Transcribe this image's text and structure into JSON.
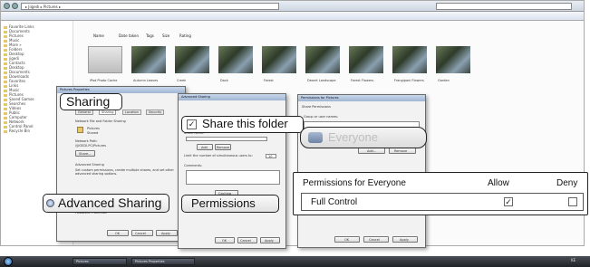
{
  "explorer": {
    "address": "▸ Jiigedi ▸ Pictures ▸",
    "sidebar": [
      {
        "label": "Favorite Links"
      },
      {
        "label": "Documents"
      },
      {
        "label": "Pictures"
      },
      {
        "label": "Music"
      },
      {
        "label": "More »"
      },
      {
        "label": "Folders"
      },
      {
        "label": "Desktop"
      },
      {
        "label": "jigedi"
      },
      {
        "label": "Contacts"
      },
      {
        "label": "Desktop"
      },
      {
        "label": "Documents"
      },
      {
        "label": "Downloads"
      },
      {
        "label": "Favorites"
      },
      {
        "label": "Links"
      },
      {
        "label": "Music"
      },
      {
        "label": "Pictures"
      },
      {
        "label": "Saved Games"
      },
      {
        "label": "Searches"
      },
      {
        "label": "Videos"
      },
      {
        "label": "Public"
      },
      {
        "label": "Computer"
      },
      {
        "label": "Network"
      },
      {
        "label": "Control Panel"
      },
      {
        "label": "Recycle Bin"
      }
    ],
    "columns": [
      "Name",
      "Date taken",
      "Tags",
      "Size",
      "Rating"
    ],
    "thumbnails": [
      {
        "caption": "iPod Photo Cache"
      },
      {
        "caption": "Autumn Leaves"
      },
      {
        "caption": "Creek"
      },
      {
        "caption": "Dock"
      },
      {
        "caption": "Forest"
      },
      {
        "caption": "Desert Landscape"
      },
      {
        "caption": "Forest Flowers"
      },
      {
        "caption": "Frangipani Flowers"
      },
      {
        "caption": "Garden"
      }
    ]
  },
  "callouts": {
    "sharing": "Sharing",
    "advanced_sharing": "Advanced Sharing",
    "share_this_folder": "Share this folder",
    "permissions": "Permissions",
    "everyone": "Everyone"
  },
  "permissions_panel": {
    "header": "Permissions for Everyone",
    "allow": "Allow",
    "deny": "Deny",
    "row_label": "Full Control",
    "allow_checked": true,
    "deny_checked": false
  },
  "dialog1": {
    "title": "Pictures Properties",
    "tabs": [
      "General",
      "Sharing",
      "Location",
      "Security"
    ],
    "section": "Network File and Folder Sharing",
    "item_name": "Pictures",
    "item_state": "Shared",
    "network_path_label": "Network Path:",
    "network_path": "\\\\JIGEDI-PC\\Pictures",
    "share_button": "Share...",
    "advanced_title": "Advanced Sharing",
    "advanced_desc": "Set custom permissions, create multiple shares, and set other advanced sharing options.",
    "pw_note": "Password Protection",
    "ok": "OK",
    "cancel": "Cancel",
    "apply": "Apply"
  },
  "dialog2": {
    "title": "Advanced Sharing",
    "settings": "Settings",
    "share_name": "Share name:",
    "add": "Add",
    "remove": "Remove",
    "limit": "Limit the number of simultaneous users to:",
    "limit_value": "10",
    "comments": "Comments:",
    "caching": "Caching",
    "ok": "OK",
    "cancel": "Cancel",
    "apply": "Apply"
  },
  "dialog3": {
    "title": "Permissions for Pictures",
    "tab": "Share Permissions",
    "group_label": "Group or user names:",
    "add": "Add...",
    "remove": "Remove",
    "ok": "OK",
    "cancel": "Cancel",
    "apply": "Apply"
  },
  "taskbar": {
    "items": [
      {
        "label": "Pictures"
      },
      {
        "label": "Pictures Properties"
      }
    ],
    "clock": "KE"
  },
  "colors": {
    "accent": "#9fb6d2",
    "taskbar": "#2b2f35"
  }
}
